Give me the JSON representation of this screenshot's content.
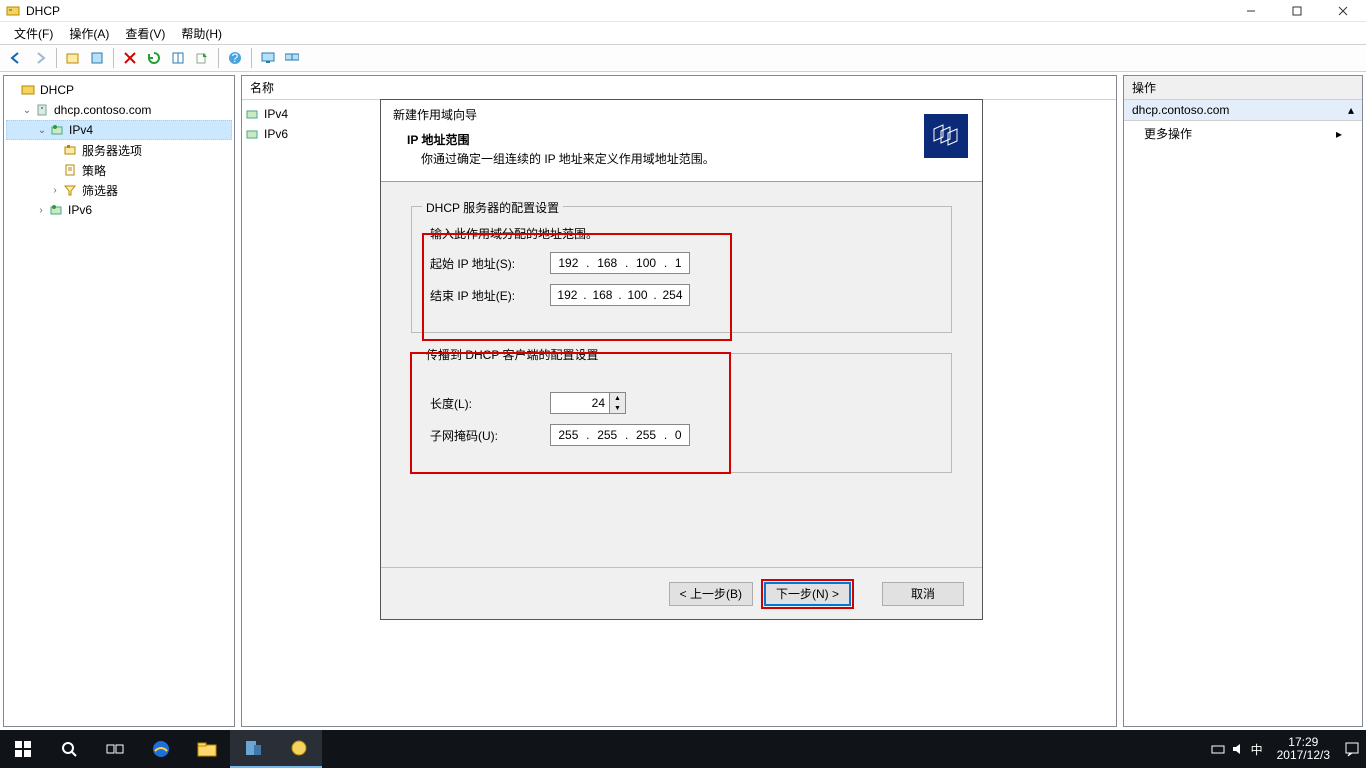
{
  "window": {
    "title": "DHCP"
  },
  "menu": {
    "file": "文件(F)",
    "action": "操作(A)",
    "view": "查看(V)",
    "help": "帮助(H)"
  },
  "tree": {
    "root": "DHCP",
    "server": "dhcp.contoso.com",
    "ipv4": "IPv4",
    "ipv4_items": {
      "server_options": "服务器选项",
      "policies": "策略",
      "filters": "筛选器"
    },
    "ipv6": "IPv6"
  },
  "center": {
    "col_name": "名称",
    "items": [
      "IPv4",
      "IPv6"
    ]
  },
  "actions": {
    "title": "操作",
    "context": "dhcp.contoso.com",
    "more": "更多操作"
  },
  "wizard": {
    "title": "新建作用域向导",
    "subtitle": "IP 地址范围",
    "desc": "你通过确定一组连续的 IP 地址来定义作用域地址范围。",
    "group1_legend": "DHCP 服务器的配置设置",
    "group1_hint": "输入此作用域分配的地址范围。",
    "start_label": "起始 IP 地址(S):",
    "start_ip": [
      "192",
      "168",
      "100",
      "1"
    ],
    "end_label": "结束 IP 地址(E):",
    "end_ip": [
      "192",
      "168",
      "100",
      "254"
    ],
    "group2_legend": "传播到 DHCP 客户端的配置设置",
    "length_label": "长度(L):",
    "length_value": "24",
    "mask_label": "子网掩码(U):",
    "mask": [
      "255",
      "255",
      "255",
      "0"
    ],
    "back": "< 上一步(B)",
    "next": "下一步(N) >",
    "cancel": "取消"
  },
  "taskbar": {
    "time": "17:29",
    "date": "2017/12/3",
    "ime": "中"
  }
}
